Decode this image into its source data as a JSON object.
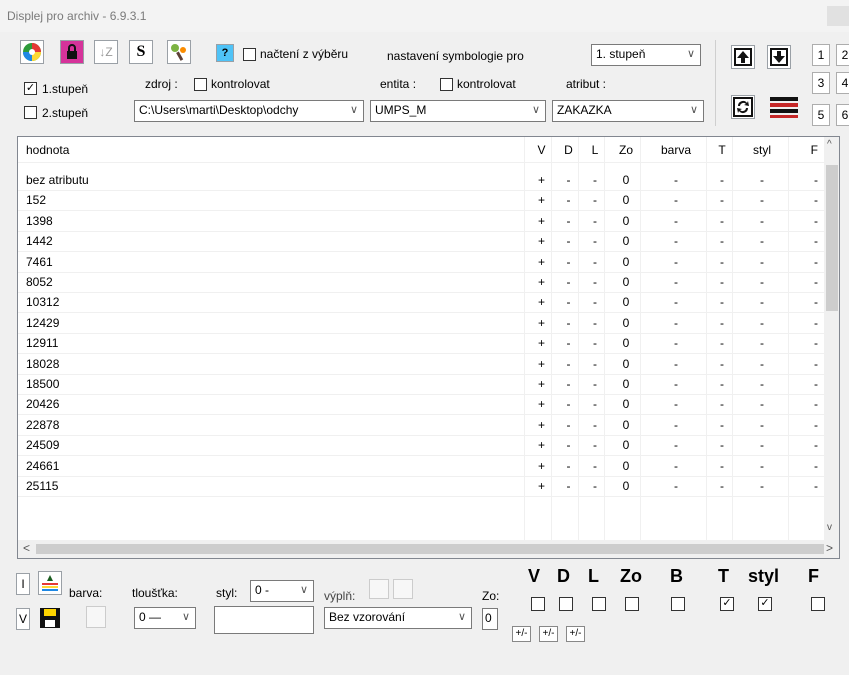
{
  "window": {
    "title": "Displej pro archiv - 6.9.3.1"
  },
  "toolbar": {
    "help_label": "?",
    "s_label": "S",
    "sort_label": "↓Z",
    "nacteni_label": "načtení z výběru",
    "nastaveni_label": "nastavení symbologie pro",
    "level_select": "1. stupeň",
    "zdroj_label": "zdroj :",
    "kontrolovat_label": "kontrolovat",
    "entita_label": "entita :",
    "atribut_label": "atribut :",
    "stupen1_label": "1.stupeň",
    "stupen2_label": "2.stupeň",
    "source_path": "C:\\Users\\marti\\Desktop\\odchy",
    "entity_value": "UMPS_M",
    "attribute_value": "ZAKAZKA",
    "numbers": [
      "1",
      "2",
      "3",
      "4",
      "5",
      "6"
    ]
  },
  "table": {
    "columns": [
      "hodnota",
      "V",
      "D",
      "L",
      "Zo",
      "barva",
      "T",
      "styl",
      "F"
    ],
    "rows": [
      [
        "bez atributu",
        "+",
        "-",
        "-",
        "0",
        "-",
        "-",
        "-",
        "-"
      ],
      [
        "152",
        "+",
        "-",
        "-",
        "0",
        "-",
        "-",
        "-",
        "-"
      ],
      [
        "1398",
        "+",
        "-",
        "-",
        "0",
        "-",
        "-",
        "-",
        "-"
      ],
      [
        "1442",
        "+",
        "-",
        "-",
        "0",
        "-",
        "-",
        "-",
        "-"
      ],
      [
        "7461",
        "+",
        "-",
        "-",
        "0",
        "-",
        "-",
        "-",
        "-"
      ],
      [
        "8052",
        "+",
        "-",
        "-",
        "0",
        "-",
        "-",
        "-",
        "-"
      ],
      [
        "10312",
        "+",
        "-",
        "-",
        "0",
        "-",
        "-",
        "-",
        "-"
      ],
      [
        "12429",
        "+",
        "-",
        "-",
        "0",
        "-",
        "-",
        "-",
        "-"
      ],
      [
        "12911",
        "+",
        "-",
        "-",
        "0",
        "-",
        "-",
        "-",
        "-"
      ],
      [
        "18028",
        "+",
        "-",
        "-",
        "0",
        "-",
        "-",
        "-",
        "-"
      ],
      [
        "18500",
        "+",
        "-",
        "-",
        "0",
        "-",
        "-",
        "-",
        "-"
      ],
      [
        "20426",
        "+",
        "-",
        "-",
        "0",
        "-",
        "-",
        "-",
        "-"
      ],
      [
        "22878",
        "+",
        "-",
        "-",
        "0",
        "-",
        "-",
        "-",
        "-"
      ],
      [
        "24509",
        "+",
        "-",
        "-",
        "0",
        "-",
        "-",
        "-",
        "-"
      ],
      [
        "24661",
        "+",
        "-",
        "-",
        "0",
        "-",
        "-",
        "-",
        "-"
      ],
      [
        "25115",
        "+",
        "-",
        "-",
        "0",
        "-",
        "-",
        "-",
        "-"
      ]
    ]
  },
  "bottom": {
    "i_label": "I",
    "v_label": "V",
    "barva_label": "barva:",
    "tloustka_label": "tloušťka:",
    "tloustka_value": "0 —",
    "styl_label": "styl:",
    "styl_value": "0 -",
    "vypln_label": "výplň:",
    "vypln_select": "Bez vzorování",
    "zo_label": "Zo:",
    "zo_value": "0",
    "flags": [
      "V",
      "D",
      "L",
      "Zo",
      "B",
      "T",
      "styl",
      "F"
    ],
    "flag_checked": [
      false,
      false,
      false,
      false,
      false,
      true,
      true,
      false
    ],
    "pm_label": "+/-"
  },
  "colors": {
    "accent": "#0078d7",
    "grid": "#f0f0f0",
    "border": "#828790"
  }
}
